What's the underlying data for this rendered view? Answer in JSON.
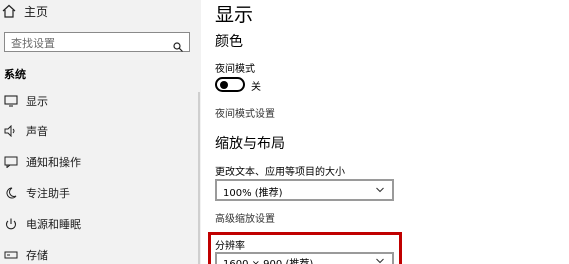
{
  "sidebar": {
    "home_label": "主页",
    "search_placeholder": "查找设置",
    "section_label": "系统",
    "items": [
      {
        "label": "显示",
        "icon": "monitor-icon"
      },
      {
        "label": "声音",
        "icon": "speaker-icon"
      },
      {
        "label": "通知和操作",
        "icon": "notification-icon"
      },
      {
        "label": "专注助手",
        "icon": "moon-icon"
      },
      {
        "label": "电源和睡眠",
        "icon": "power-icon"
      },
      {
        "label": "存储",
        "icon": "storage-icon"
      }
    ]
  },
  "main": {
    "title": "显示",
    "color_heading": "颜色",
    "night_mode_label": "夜间模式",
    "night_mode_state": "关",
    "night_mode_settings_link": "夜间模式设置",
    "scale_heading": "缩放与布局",
    "scale_label": "更改文本、应用等项目的大小",
    "scale_value": "100% (推荐)",
    "advanced_scale_link": "高级缩放设置",
    "resolution_label": "分辨率",
    "resolution_value": "1600 × 900 (推荐)"
  },
  "colors": {
    "highlight": "#c00000",
    "sidebar_bg": "#f2f2f2"
  }
}
